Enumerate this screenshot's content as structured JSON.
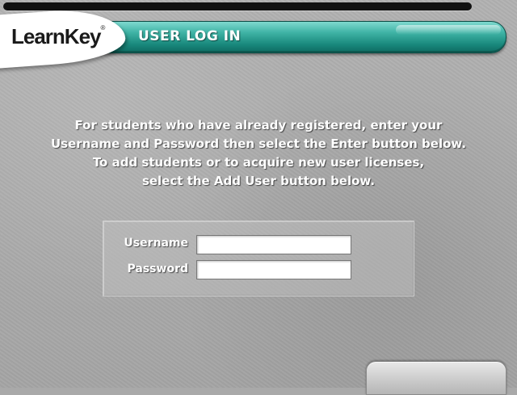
{
  "header": {
    "logo_text": "LearnKey",
    "logo_mark": "®",
    "title": "USER LOG IN"
  },
  "instructions": {
    "line1": "For students who have already registered, enter your",
    "line2": "Username and Password then select the Enter button below.",
    "line3": "To add students or to acquire new user licenses,",
    "line4": "select the Add User button below."
  },
  "form": {
    "username_label": "Username",
    "username_value": "",
    "password_label": "Password",
    "password_value": ""
  },
  "colors": {
    "accent_teal": "#18877b",
    "background_gray": "#a9a9a9"
  }
}
